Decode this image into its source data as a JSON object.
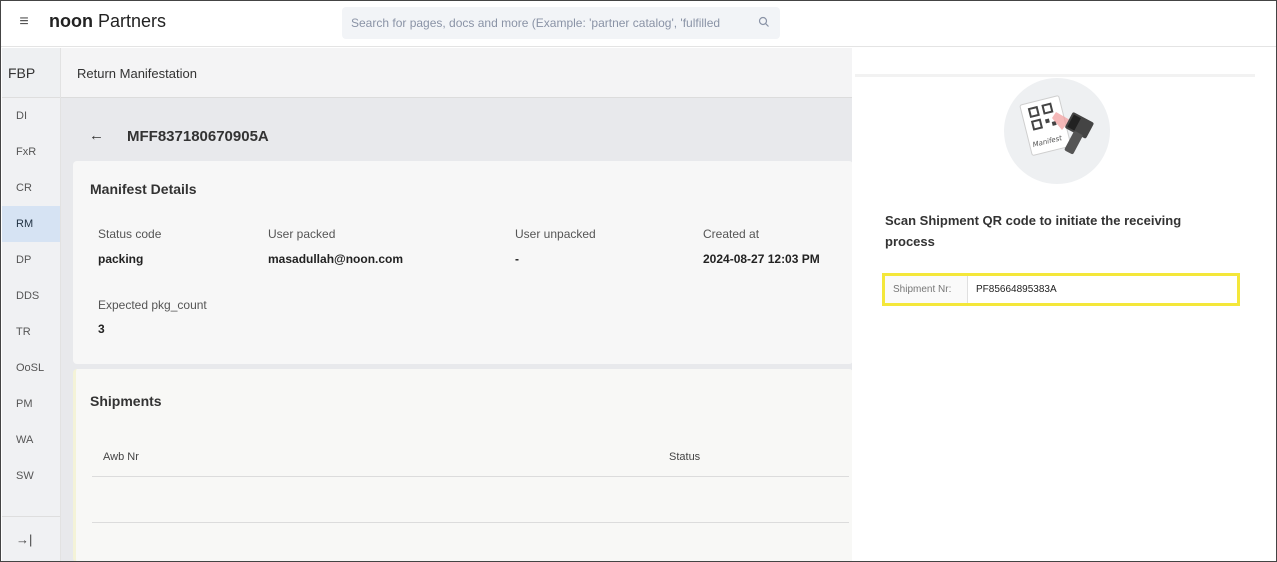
{
  "topbar": {
    "logo_bold": "noon",
    "logo_rest": " Partners",
    "search_placeholder": "Search for pages, docs and more (Example: 'partner catalog', 'fulfilled"
  },
  "sidebar": {
    "header": "FBP",
    "items": [
      {
        "label": "DI"
      },
      {
        "label": "FxR"
      },
      {
        "label": "CR"
      },
      {
        "label": "RM",
        "active": true
      },
      {
        "label": "DP"
      },
      {
        "label": "DDS"
      },
      {
        "label": "TR"
      },
      {
        "label": "OoSL"
      },
      {
        "label": "PM"
      },
      {
        "label": "WA"
      },
      {
        "label": "SW"
      }
    ],
    "collapse_glyph": "→|"
  },
  "main": {
    "breadcrumb": "Return Manifestation",
    "back_glyph": "←",
    "manifest_id": "MFF837180670905A",
    "details": {
      "title": "Manifest Details",
      "fields": [
        {
          "label": "Status code",
          "value": "packing"
        },
        {
          "label": "User packed",
          "value": "masadullah@noon.com"
        },
        {
          "label": "User unpacked",
          "value": "-"
        },
        {
          "label": "Created at",
          "value": "2024-08-27 12:03 PM"
        },
        {
          "label": "Expected pkg_count",
          "value": "3"
        }
      ]
    },
    "shipments": {
      "title": "Shipments",
      "columns": [
        "Awb Nr",
        "Status"
      ]
    }
  },
  "drawer": {
    "illustration_text": "Manifest",
    "scan_title": "Scan Shipment QR code to initiate the receiving process",
    "shipment_label": "Shipment Nr:",
    "shipment_value": "PF85664895383A"
  },
  "colors": {
    "highlight": "#f4e73a",
    "active_nav": "#d6e3f3"
  }
}
